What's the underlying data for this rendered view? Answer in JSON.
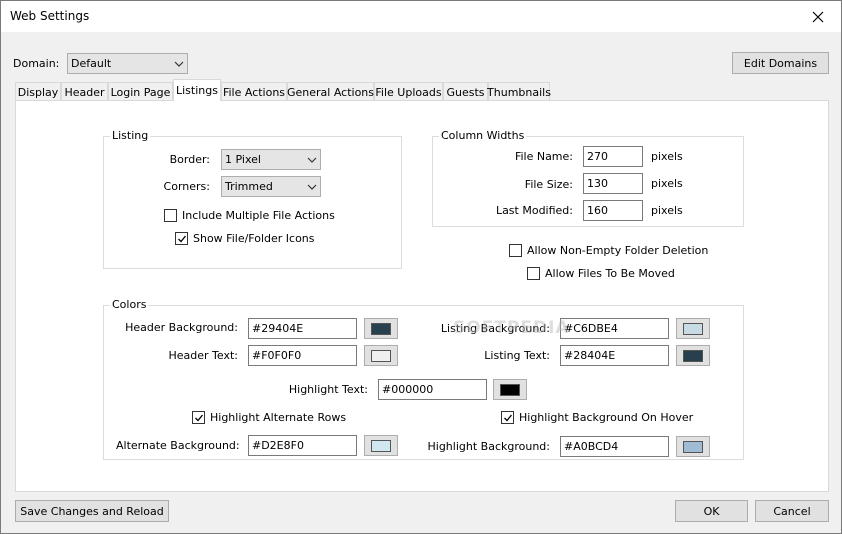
{
  "window": {
    "title": "Web Settings"
  },
  "domain": {
    "label": "Domain:",
    "value": "Default",
    "edit_button": "Edit Domains"
  },
  "tabs": [
    {
      "label": "Display"
    },
    {
      "label": "Header"
    },
    {
      "label": "Login Page"
    },
    {
      "label": "Listings",
      "active": true
    },
    {
      "label": "File Actions"
    },
    {
      "label": "General Actions"
    },
    {
      "label": "File Uploads"
    },
    {
      "label": "Guests"
    },
    {
      "label": "Thumbnails"
    }
  ],
  "listing": {
    "title": "Listing",
    "border_label": "Border:",
    "border_value": "1 Pixel",
    "corners_label": "Corners:",
    "corners_value": "Trimmed",
    "include_multiple_label": "Include Multiple File Actions",
    "include_multiple_checked": false,
    "show_icons_label": "Show File/Folder Icons",
    "show_icons_checked": true
  },
  "column_widths": {
    "title": "Column Widths",
    "unit": "pixels",
    "rows": [
      {
        "label": "File Name:",
        "value": "270"
      },
      {
        "label": "File Size:",
        "value": "130"
      },
      {
        "label": "Last Modified:",
        "value": "160"
      }
    ]
  },
  "options": {
    "allow_nonempty_label": "Allow Non-Empty Folder Deletion",
    "allow_nonempty_checked": false,
    "allow_move_label": "Allow Files To Be Moved",
    "allow_move_checked": false
  },
  "colors": {
    "title": "Colors",
    "header_bg_label": "Header Background:",
    "header_bg_value": "#29404E",
    "header_text_label": "Header Text:",
    "header_text_value": "#F0F0F0",
    "listing_bg_label": "Listing Background:",
    "listing_bg_value": "#C6DBE4",
    "listing_text_label": "Listing Text:",
    "listing_text_value": "#28404E",
    "highlight_text_label": "Highlight Text:",
    "highlight_text_value": "#000000",
    "highlight_alt_rows_label": "Highlight Alternate Rows",
    "highlight_alt_rows_checked": true,
    "highlight_bg_hover_label": "Highlight Background On Hover",
    "highlight_bg_hover_checked": true,
    "alternate_bg_label": "Alternate Background:",
    "alternate_bg_value": "#D2E8F0",
    "highlight_bg_label": "Highlight Background:",
    "highlight_bg_value": "#A0BCD4"
  },
  "buttons": {
    "save_reload": "Save Changes and Reload",
    "ok": "OK",
    "cancel": "Cancel"
  },
  "watermark": "SOFTPEDIA"
}
